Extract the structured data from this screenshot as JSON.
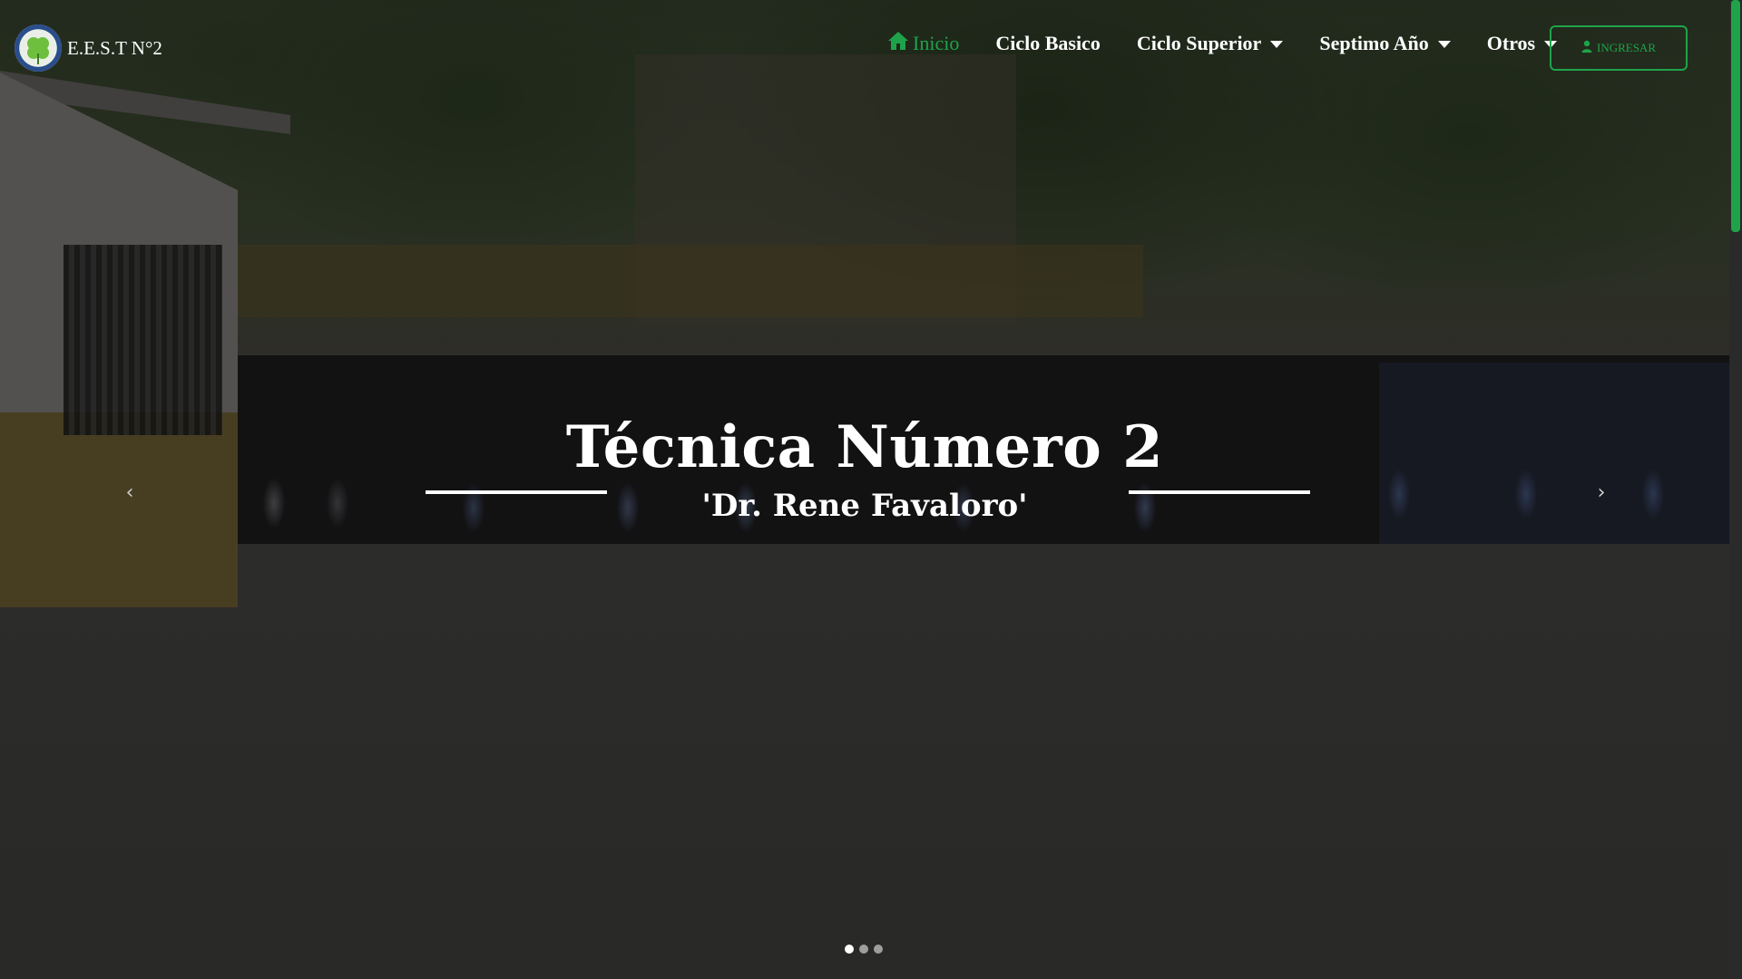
{
  "brand": {
    "text": "E.E.S.T N°2",
    "logo_icon": "clover-crest-icon"
  },
  "nav": {
    "items": [
      {
        "label": "Inicio",
        "icon": "home-icon",
        "active": true,
        "dropdown": false
      },
      {
        "label": "Ciclo Basico",
        "active": false,
        "dropdown": false
      },
      {
        "label": "Ciclo Superior",
        "active": false,
        "dropdown": true
      },
      {
        "label": "Septimo Año",
        "active": false,
        "dropdown": true
      },
      {
        "label": "Otros",
        "active": false,
        "dropdown": true
      }
    ],
    "login_label": "INGRESAR",
    "login_icon": "user-icon"
  },
  "hero": {
    "title": "Técnica Número 2",
    "subtitle": "'Dr. Rene Favaloro'",
    "prev_icon": "chevron-left-icon",
    "next_icon": "chevron-right-icon",
    "prev_glyph": "‹",
    "next_glyph": "›",
    "slide_count": 3,
    "active_slide": 1
  },
  "colors": {
    "accent": "#1fa34a",
    "text": "#ffffff"
  }
}
